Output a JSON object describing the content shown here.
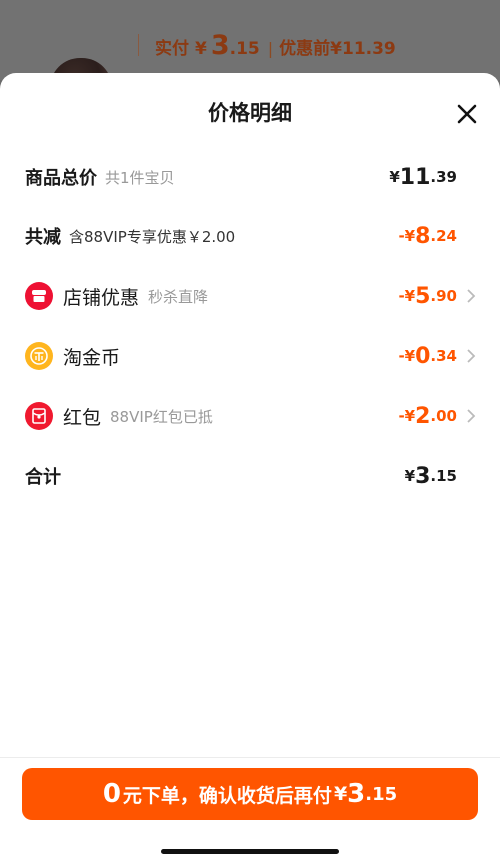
{
  "backdrop": {
    "paid_label": "实付",
    "paid_currency": "¥",
    "paid_int": "3",
    "paid_dec": ".15",
    "separator": "|",
    "pre_discount": "优惠前¥11.39"
  },
  "sheet": {
    "title": "价格明细"
  },
  "rows": {
    "total_goods": {
      "label": "商品总价",
      "sub": "共1件宝贝",
      "currency": "¥",
      "int": "11",
      "dec": ".39"
    },
    "total_reduce": {
      "label": "共减",
      "sub": "含88VIP专享优惠￥2.00",
      "currency": "-¥",
      "int": "8",
      "dec": ".24"
    },
    "shop_discount": {
      "label": "店铺优惠",
      "sub": "秒杀直降",
      "currency": "-¥",
      "int": "5",
      "dec": ".90"
    },
    "taojinbi": {
      "label": "淘金币",
      "currency": "-¥",
      "int": "0",
      "dec": ".34"
    },
    "red_packet": {
      "label": "红包",
      "sub": "88VIP红包已抵",
      "currency": "-¥",
      "int": "2",
      "dec": ".00"
    },
    "sum": {
      "label": "合计",
      "currency": "¥",
      "int": "3",
      "dec": ".15"
    }
  },
  "confirm": {
    "big": "0",
    "text": "元下单，确认收货后再付",
    "currency": "¥",
    "int": "3",
    "dec": ".15"
  },
  "icons": {
    "close": "close-icon",
    "shop": "shop-icon",
    "coin": "coin-icon",
    "redpacket": "red-packet-icon",
    "chevron": "chevron-right-icon"
  },
  "colors": {
    "accent": "#ff5500",
    "shop_icon": "#ee1133",
    "coin_icon": "#ffb51e",
    "redpacket_icon": "#f0192f"
  }
}
